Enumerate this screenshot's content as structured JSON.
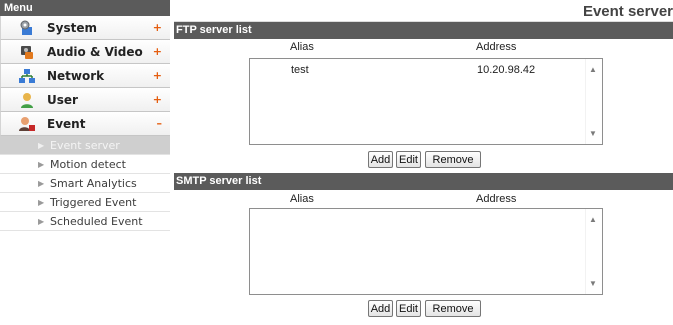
{
  "sidebar": {
    "title": "Menu",
    "categories": [
      {
        "label": "System",
        "toggle": "+"
      },
      {
        "label": "Audio & Video",
        "toggle": "+"
      },
      {
        "label": "Network",
        "toggle": "+"
      },
      {
        "label": "User",
        "toggle": "+"
      },
      {
        "label": "Event",
        "toggle": "–"
      }
    ],
    "subitems": [
      {
        "label": "Event server",
        "active": true
      },
      {
        "label": "Motion detect"
      },
      {
        "label": "Smart Analytics"
      },
      {
        "label": "Triggered Event"
      },
      {
        "label": "Scheduled Event"
      }
    ]
  },
  "page": {
    "title": "Event server"
  },
  "ftp": {
    "section_title": "FTP server list",
    "col_alias": "Alias",
    "col_address": "Address",
    "rows": [
      {
        "alias": "test",
        "address": "10.20.98.42"
      }
    ],
    "add": "Add",
    "edit": "Edit",
    "remove": "Remove"
  },
  "smtp": {
    "section_title": "SMTP server list",
    "col_alias": "Alias",
    "col_address": "Address",
    "rows": [],
    "add": "Add",
    "edit": "Edit",
    "remove": "Remove"
  },
  "colors": {
    "header_bg": "#5b5b5b",
    "accent": "#e55e10",
    "active_item_bg": "#cfcfcf"
  }
}
